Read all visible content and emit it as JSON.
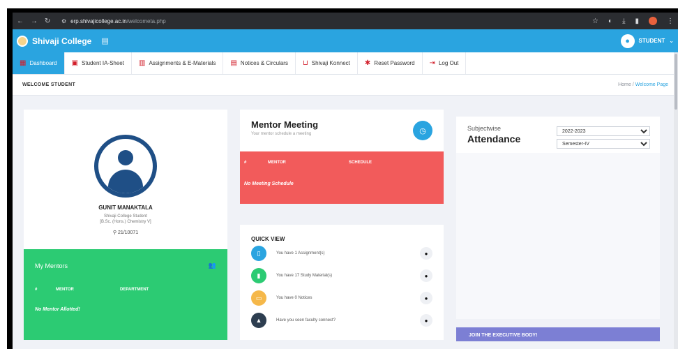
{
  "browser": {
    "url_site": "erp.shivajicollege.ac.in",
    "url_path": "/welcometa.php"
  },
  "app": {
    "brand": "Shivaji College",
    "user_label": "STUDENT"
  },
  "tabs": [
    {
      "label": "Dashboard"
    },
    {
      "label": "Student IA-Sheet"
    },
    {
      "label": "Assignments & E-Materials"
    },
    {
      "label": "Notices & Circulars"
    },
    {
      "label": "Shivaji Konnect"
    },
    {
      "label": "Reset Password"
    },
    {
      "label": "Log Out"
    }
  ],
  "crumb": {
    "welcome": "WELCOME STUDENT",
    "home": "Home",
    "sep": "/",
    "current": "Welcome Page"
  },
  "profile": {
    "name": "GUNIT MANAKTALA",
    "line1": "Shivaji College Student",
    "line2": "[B.Sc. (Hons.) Chemistry V]",
    "id": "21/10071"
  },
  "mentors": {
    "title": "My Mentors",
    "col_hash": "#",
    "col_mentor": "MENTOR",
    "col_dept": "DEPARTMENT",
    "empty": "No Mentor Allotted!"
  },
  "meeting": {
    "title": "Mentor Meeting",
    "desc": "Your mentor schedule a meeting",
    "col_hash": "#",
    "col_mentor": "MENTOR",
    "col_schedule": "SCHEDULE",
    "empty": "No Meeting Schedule"
  },
  "quick_view": {
    "title": "QUICK VIEW",
    "items": [
      {
        "text": "You have 1 Assignment(s)",
        "color": "#2aa4e0"
      },
      {
        "text": "You have 17 Study Material(s)",
        "color": "#2ccb73"
      },
      {
        "text": "You have 0 Notices",
        "color": "#f5b84a"
      },
      {
        "text": "Have you seen faculty connect?",
        "color": "#2d3e50"
      }
    ]
  },
  "attendance": {
    "label1": "Subjectwise",
    "label2": "Attendance",
    "year_selected": "2022-2023",
    "semester_selected": "Semester-IV"
  },
  "exec": {
    "label": "JOIN THE EXECUTIVE BODY!"
  }
}
